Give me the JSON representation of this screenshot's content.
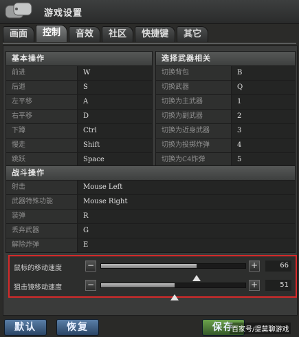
{
  "window": {
    "title": "游戏设置"
  },
  "tabs": [
    "画面",
    "控制",
    "音效",
    "社区",
    "快捷键",
    "其它"
  ],
  "active_tab": "控制",
  "basic": {
    "title": "基本操作",
    "rows": [
      {
        "label": "前进",
        "key": "W"
      },
      {
        "label": "后退",
        "key": "S"
      },
      {
        "label": "左平移",
        "key": "A"
      },
      {
        "label": "右平移",
        "key": "D"
      },
      {
        "label": "下蹲",
        "key": "Ctrl"
      },
      {
        "label": "慢走",
        "key": "Shift"
      },
      {
        "label": "跳跃",
        "key": "Space"
      }
    ]
  },
  "weapons": {
    "title": "选择武器相关",
    "rows": [
      {
        "label": "切换背包",
        "key": "B"
      },
      {
        "label": "切换武器",
        "key": "Q"
      },
      {
        "label": "切换为主武器",
        "key": "1"
      },
      {
        "label": "切换为副武器",
        "key": "2"
      },
      {
        "label": "切换为近身武器",
        "key": "3"
      },
      {
        "label": "切换为投掷炸弹",
        "key": "4"
      },
      {
        "label": "切换为C4炸弹",
        "key": "5"
      }
    ]
  },
  "combat": {
    "title": "战斗操作",
    "rows": [
      {
        "label": "射击",
        "key": "Mouse Left"
      },
      {
        "label": "武器特殊功能",
        "key": "Mouse Right"
      },
      {
        "label": "装弹",
        "key": "R"
      },
      {
        "label": "丢弃武器",
        "key": "G"
      },
      {
        "label": "解除炸弹",
        "key": "E"
      }
    ]
  },
  "sliders": [
    {
      "label": "鼠标的移动速度",
      "value": "66",
      "level": 0.66
    },
    {
      "label": "狙击镜移动速度",
      "value": "51",
      "level": 0.51
    }
  ],
  "buttons": {
    "default": "默认",
    "restore": "恢复",
    "save": "保存"
  },
  "watermark": "百家号/提莫聊游戏",
  "colors": {
    "highlight_border": "#d52a2a",
    "button_blue": "#3a5a80",
    "button_green": "#4d7f36"
  }
}
